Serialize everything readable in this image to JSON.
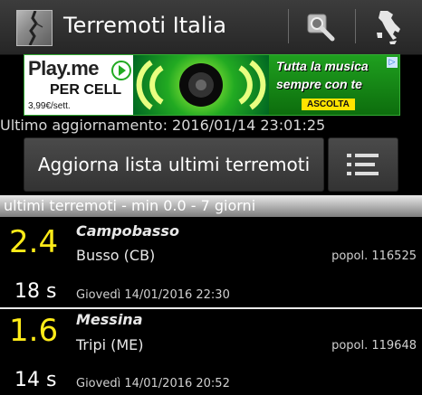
{
  "actionbar": {
    "title": "Terremoti Italia",
    "search_icon": "search-tool-icon",
    "map_icon": "italy-map-icon"
  },
  "ad": {
    "logo": "Play.me",
    "subtitle": "PER CELL",
    "price": "3,99€/sett.",
    "line1": "Tutta la musica",
    "line2": "sempre con te",
    "cta": "ASCOLTA",
    "colors": {
      "green": "#1fa01f",
      "yellow": "#ffe400"
    }
  },
  "status": {
    "last_update": "Ultimo aggiornamento: 2016/01/14 23:01:25"
  },
  "buttons": {
    "refresh_label": "Aggiorna lista ultimi terremoti",
    "list_icon": "list-icon"
  },
  "section": {
    "header": "ultimi terremoti - min 0.0 - 7 giorni"
  },
  "quakes": [
    {
      "magnitude": "2.4",
      "area": "Campobasso",
      "place": "Busso (CB)",
      "population": "popol. 116525",
      "ago": "18 s",
      "datetime": "Giovedì 14/01/2016 22:30"
    },
    {
      "magnitude": "1.6",
      "area": "Messina",
      "place": "Tripi (ME)",
      "population": "popol. 119648",
      "ago": "14 s",
      "datetime": "Giovedì 14/01/2016 20:52"
    }
  ],
  "colors": {
    "magnitude": "#ffeb18",
    "background": "#000000",
    "divider": "#eaeaea"
  }
}
